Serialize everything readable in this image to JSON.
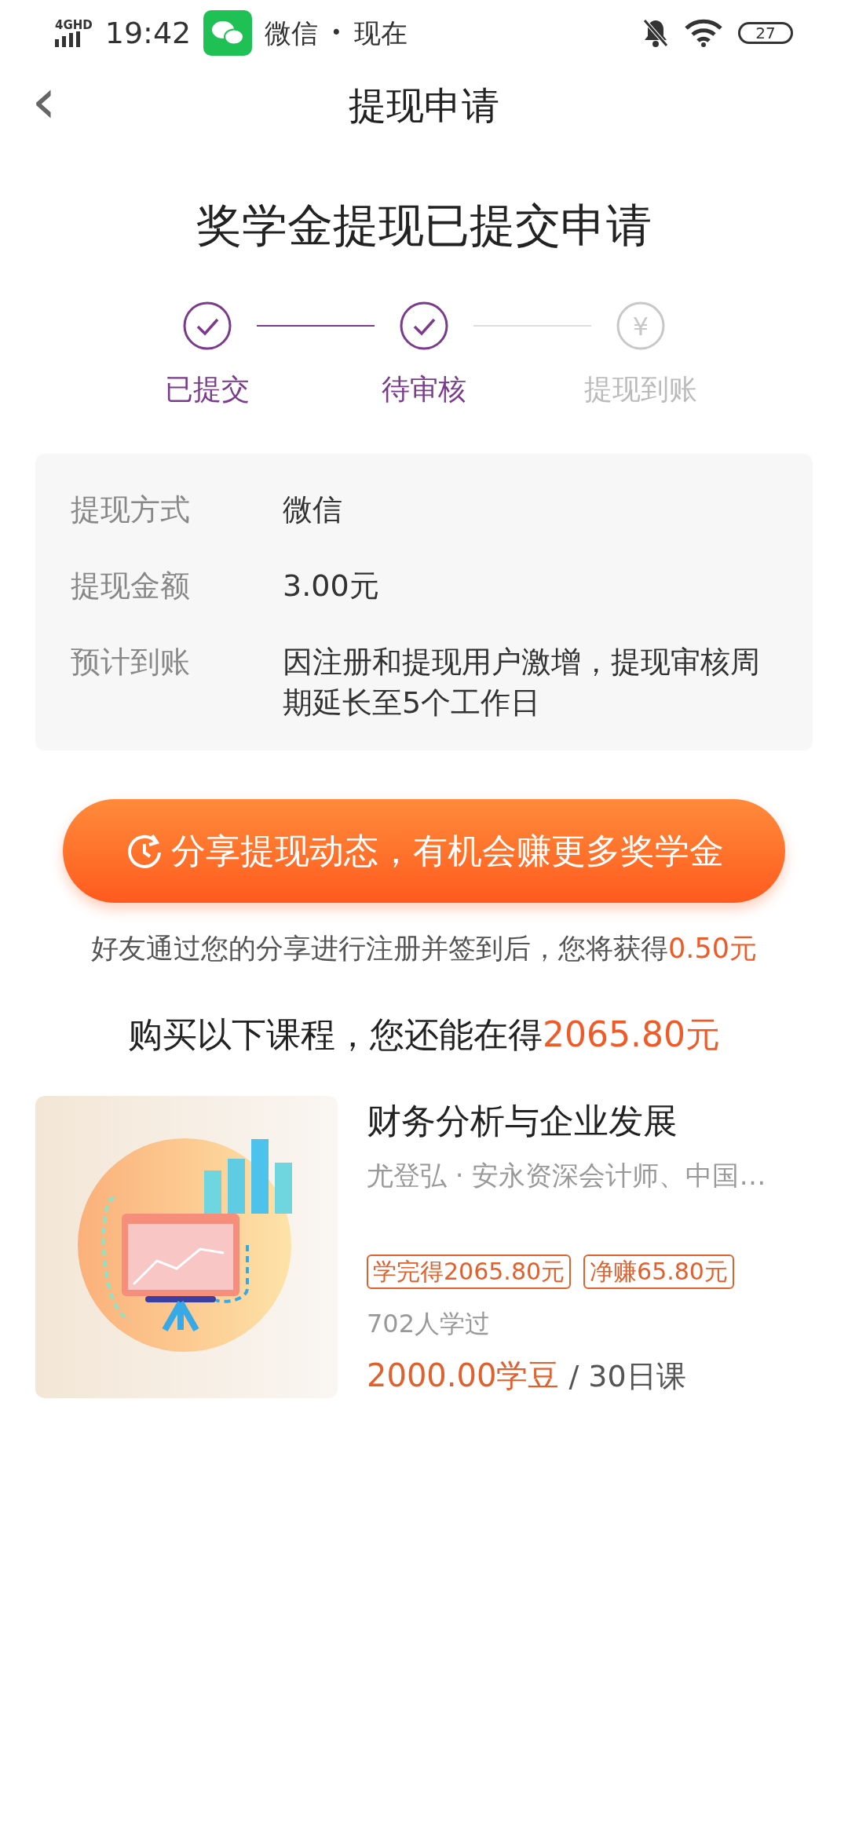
{
  "status_bar": {
    "network": "4GHD",
    "time": "19:42",
    "notification": {
      "app": "微信",
      "separator": "•",
      "time": "现在"
    },
    "battery": "27"
  },
  "header": {
    "back": "‹",
    "title": "提现申请"
  },
  "heading": "奖学金提现已提交申请",
  "steps": [
    {
      "label": "已提交",
      "done": true,
      "kind": "check"
    },
    {
      "label": "待审核",
      "done": true,
      "kind": "check"
    },
    {
      "label": "提现到账",
      "done": false,
      "kind": "yen",
      "icon": "¥"
    }
  ],
  "details": [
    {
      "label": "提现方式",
      "value": "微信"
    },
    {
      "label": "提现金额",
      "value": "3.00元"
    },
    {
      "label": "预计到账",
      "value": "因注册和提现用户激增，提现审核周期延长至5个工作日"
    }
  ],
  "share_button": "分享提现动态，有机会赚更多奖学金",
  "share_note": {
    "text": "好友通过您的分享进行注册并签到后，您将获得",
    "amount": "0.50元"
  },
  "courses_heading": {
    "text": "购买以下课程，您还能在得",
    "amount": "2065.80元"
  },
  "courses": [
    {
      "title": "财务分析与企业发展",
      "author": "尤登弘 · 安永资深会计师、中国…",
      "tags": [
        "学完得2065.80元",
        "净赚65.80元"
      ],
      "learners": "702人学过",
      "price": "2000.00学豆",
      "duration": "/ 30日课"
    }
  ]
}
